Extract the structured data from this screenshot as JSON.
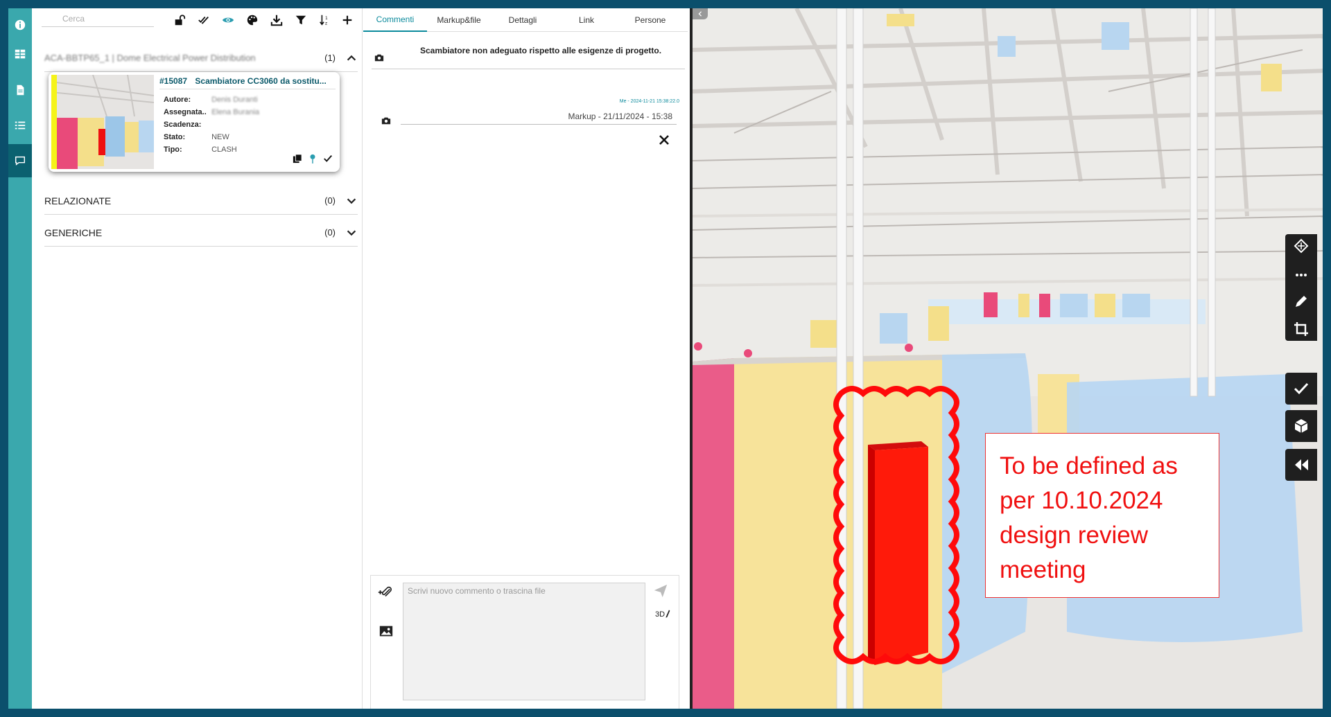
{
  "rail": {
    "items": [
      {
        "name": "info-icon"
      },
      {
        "name": "table-icon"
      },
      {
        "name": "document-icon"
      },
      {
        "name": "list-icon"
      },
      {
        "name": "comment-icon",
        "active": true
      }
    ]
  },
  "list": {
    "search_placeholder": "Cerca",
    "toolbar_icons": [
      "lock-open-icon",
      "double-check-icon",
      "eye-icon",
      "palette-icon",
      "download-icon",
      "filter-icon",
      "sort-icon",
      "plus-icon"
    ],
    "groups": [
      {
        "title": "ACA-BBTP65_1 | Dome Electrical Power Distribution",
        "count": "(1)",
        "expanded": true
      },
      {
        "title": "RELAZIONATE",
        "count": "(0)",
        "expanded": false
      },
      {
        "title": "GENERICHE",
        "count": "(0)",
        "expanded": false
      }
    ],
    "card": {
      "number": "#15087",
      "title": "Scambiatore CC3060 da sostitu...",
      "fields": [
        {
          "label": "Autore:",
          "value": "Denis Duranti",
          "blurred": true
        },
        {
          "label": "Assegnata..",
          "value": "Elena Burania",
          "blurred": true
        },
        {
          "label": "Scadenza:",
          "value": "",
          "blurred": false
        },
        {
          "label": "Stato:",
          "value": "NEW",
          "blurred": false
        },
        {
          "label": "Tipo:",
          "value": "CLASH",
          "blurred": false
        }
      ]
    }
  },
  "comments": {
    "tabs": [
      "Commenti",
      "Markup&file",
      "Dettagli",
      "Link",
      "Persone"
    ],
    "active_tab": "Commenti",
    "first_comment": "Scambiatore non adeguato rispetto alle esigenze di progetto.",
    "markup_meta": "Me - 2024-11-21 15:38:22.0",
    "markup_label": "Markup - 21/11/2024 - 15:38",
    "composer_placeholder": "Scrivi nuovo commento o trascina file",
    "composer_3d_label": "3D"
  },
  "viewer": {
    "annotation_text": "To be defined as per 10.10.2024 design review meeting",
    "annotation_color": "#f01010",
    "tools": [
      "section-icon",
      "more-icon",
      "pen-icon",
      "crop-icon",
      "check-icon",
      "cube-icon",
      "rewind-icon"
    ]
  }
}
